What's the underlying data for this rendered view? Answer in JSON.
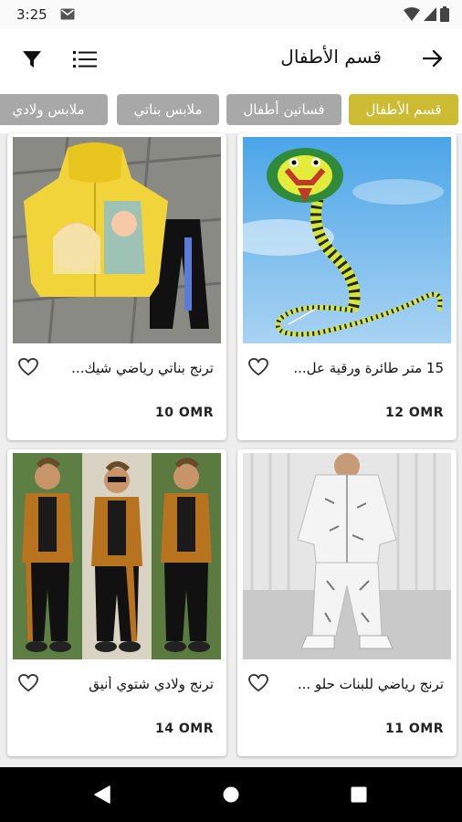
{
  "status_bar": {
    "time": "3:25"
  },
  "app_bar": {
    "title": "قسم الأطفال"
  },
  "categories": [
    {
      "label": "قسم الأطفال",
      "active": true
    },
    {
      "label": "فساتين أطفال",
      "active": false
    },
    {
      "label": "ملابس بناتي",
      "active": false
    },
    {
      "label": "ملابس ولادي",
      "active": false
    }
  ],
  "products": [
    {
      "name": "15 متر طائرة ورقية عل...",
      "price": "12 OMR"
    },
    {
      "name": "ترنج بناتي رياضي شيك...",
      "price": "10 OMR"
    },
    {
      "name": "ترنج رياضي للبنات حلو ...",
      "price": "11 OMR"
    },
    {
      "name": "ترنج ولادي شتوي أنيق",
      "price": "14 OMR"
    }
  ],
  "colors": {
    "accent": "#cdbb33",
    "chip_inactive": "#a8a8a8"
  }
}
